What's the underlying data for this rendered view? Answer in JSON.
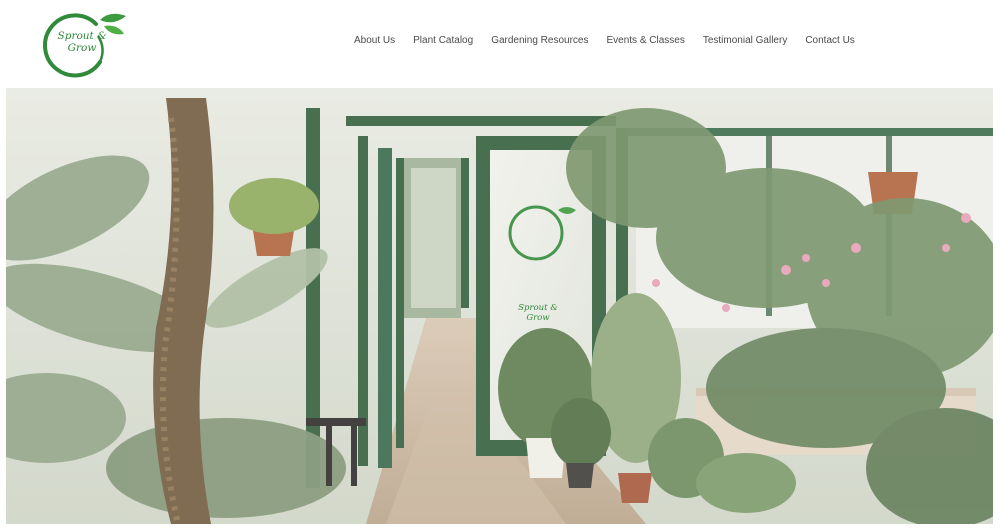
{
  "brand": {
    "name_line1": "Sprout &",
    "name_line2": "Grow"
  },
  "nav": {
    "items": [
      {
        "label": "About Us"
      },
      {
        "label": "Plant Catalog"
      },
      {
        "label": "Gardening Resources"
      },
      {
        "label": "Events & Classes"
      },
      {
        "label": "Testimonial Gallery"
      },
      {
        "label": "Contact Us"
      }
    ]
  },
  "hero": {
    "door_sign_line1": "Sprout &",
    "door_sign_line2": "Grow"
  },
  "colors": {
    "brand_green": "#2f8a3a",
    "frame_green": "#2f5e3c",
    "nav_text": "#4a4a4a"
  }
}
